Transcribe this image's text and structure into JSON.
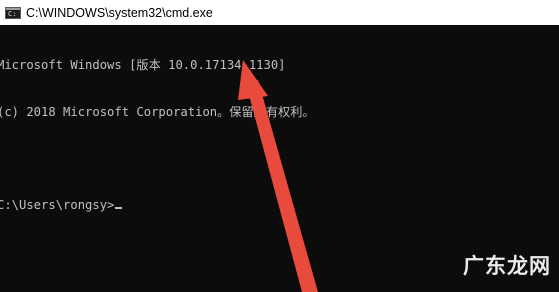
{
  "window": {
    "title": "C:\\WINDOWS\\system32\\cmd.exe",
    "icon": "cmd-icon"
  },
  "console": {
    "lines": [
      "Microsoft Windows [版本 10.0.17134.1130]",
      "(c) 2018 Microsoft Corporation。保留所有权利。"
    ],
    "prompt": "C:\\Users\\rongsy>"
  },
  "overlay": {
    "arrow_color": "#e84a3c",
    "watermark": "广东龙网"
  }
}
